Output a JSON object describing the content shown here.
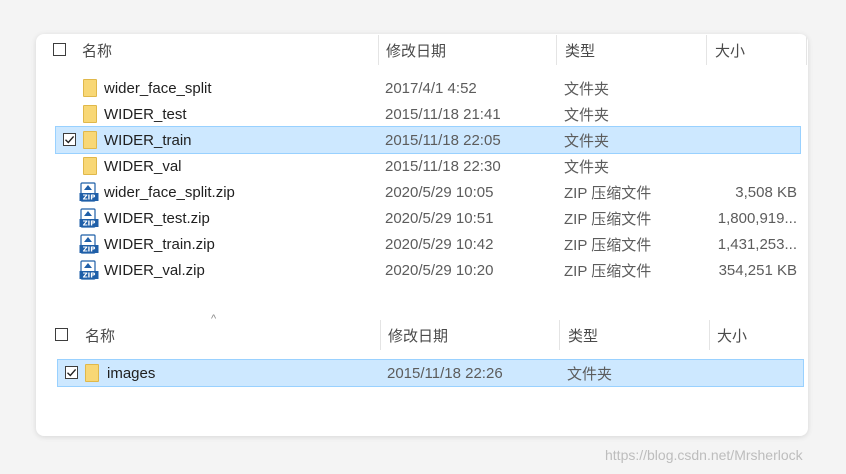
{
  "view1": {
    "headers": {
      "name": "名称",
      "date": "修改日期",
      "type": "类型",
      "size": "大小"
    },
    "rows": [
      {
        "name": "wider_face_split",
        "date": "2017/4/1 4:52",
        "type": "文件夹",
        "size": "",
        "icon": "folder-icon"
      },
      {
        "name": "WIDER_test",
        "date": "2015/11/18 21:41",
        "type": "文件夹",
        "size": "",
        "icon": "folder-icon"
      },
      {
        "name": "WIDER_train",
        "date": "2015/11/18 22:05",
        "type": "文件夹",
        "size": "",
        "icon": "folder-icon",
        "selected": true
      },
      {
        "name": "WIDER_val",
        "date": "2015/11/18 22:30",
        "type": "文件夹",
        "size": "",
        "icon": "folder-icon"
      },
      {
        "name": "wider_face_split.zip",
        "date": "2020/5/29 10:05",
        "type": "ZIP 压缩文件",
        "size": "3,508 KB",
        "icon": "zip-archive-icon"
      },
      {
        "name": "WIDER_test.zip",
        "date": "2020/5/29 10:51",
        "type": "ZIP 压缩文件",
        "size": "1,800,919...",
        "icon": "zip-archive-icon"
      },
      {
        "name": "WIDER_train.zip",
        "date": "2020/5/29 10:42",
        "type": "ZIP 压缩文件",
        "size": "1,431,253...",
        "icon": "zip-archive-icon"
      },
      {
        "name": "WIDER_val.zip",
        "date": "2020/5/29 10:20",
        "type": "ZIP 压缩文件",
        "size": "354,251 KB",
        "icon": "zip-archive-icon"
      }
    ]
  },
  "view2": {
    "sort_indicator": "^",
    "headers": {
      "name": "名称",
      "date": "修改日期",
      "type": "类型",
      "size": "大小"
    },
    "rows": [
      {
        "name": "images",
        "date": "2015/11/18 22:26",
        "type": "文件夹",
        "size": "",
        "icon": "folder-icon",
        "selected": true
      }
    ]
  },
  "watermark": "https://blog.csdn.net/Mrsherlock",
  "colors": {
    "selection": "#cde8ff",
    "selection_border": "#99d1ff",
    "folder": "#f8d775",
    "zip_icon": "#1f5fa8"
  }
}
